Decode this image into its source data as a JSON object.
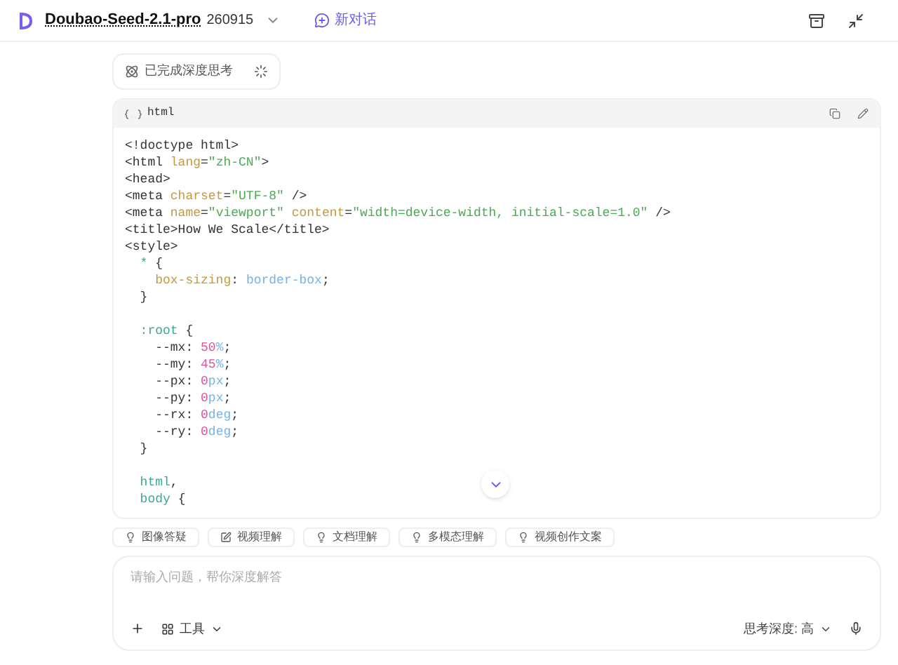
{
  "header": {
    "model": "Doubao-Seed-2.1-pro",
    "version": "260915",
    "new_chat": "新对话"
  },
  "thinking": {
    "label": "已完成深度思考"
  },
  "code_block": {
    "language": "html",
    "lines": [
      {
        "tokens": [
          {
            "kind": "tag",
            "text": "<!doctype html>"
          }
        ]
      },
      {
        "tokens": [
          {
            "kind": "tag",
            "text": "<html "
          },
          {
            "kind": "attr",
            "text": "lang"
          },
          {
            "kind": "tag",
            "text": "="
          },
          {
            "kind": "string",
            "text": "\"zh-CN\""
          },
          {
            "kind": "tag",
            "text": ">"
          }
        ]
      },
      {
        "tokens": [
          {
            "kind": "tag",
            "text": "<head>"
          }
        ]
      },
      {
        "tokens": [
          {
            "kind": "tag",
            "text": "<meta "
          },
          {
            "kind": "attr",
            "text": "charset"
          },
          {
            "kind": "tag",
            "text": "="
          },
          {
            "kind": "string",
            "text": "\"UTF-8\""
          },
          {
            "kind": "tag",
            "text": " />"
          }
        ]
      },
      {
        "tokens": [
          {
            "kind": "tag",
            "text": "<meta "
          },
          {
            "kind": "attr",
            "text": "name"
          },
          {
            "kind": "tag",
            "text": "="
          },
          {
            "kind": "string",
            "text": "\"viewport\""
          },
          {
            "kind": "attr",
            "text": " content"
          },
          {
            "kind": "tag",
            "text": "="
          },
          {
            "kind": "string",
            "text": "\"width=device-width, initial-scale=1.0\""
          },
          {
            "kind": "tag",
            "text": " />"
          }
        ]
      },
      {
        "tokens": [
          {
            "kind": "tag",
            "text": "<title>How We Scale</title>"
          }
        ]
      },
      {
        "tokens": [
          {
            "kind": "tag",
            "text": "<style>"
          }
        ]
      },
      {
        "tokens": [
          {
            "kind": "selector",
            "text": "  * "
          },
          {
            "kind": "tag",
            "text": "{"
          }
        ]
      },
      {
        "tokens": [
          {
            "kind": "attr",
            "text": "    box-sizing"
          },
          {
            "kind": "tag",
            "text": ": "
          },
          {
            "kind": "value",
            "text": "border-box"
          },
          {
            "kind": "tag",
            "text": ";"
          }
        ]
      },
      {
        "tokens": [
          {
            "kind": "tag",
            "text": "  }"
          }
        ]
      },
      {
        "gap_before": true,
        "tokens": [
          {
            "kind": "selector",
            "text": "  :root "
          },
          {
            "kind": "tag",
            "text": "{"
          }
        ]
      },
      {
        "tokens": [
          {
            "kind": "tag",
            "text": "    --mx: "
          },
          {
            "kind": "number",
            "text": "50"
          },
          {
            "kind": "value",
            "text": "%"
          },
          {
            "kind": "tag",
            "text": ";"
          }
        ]
      },
      {
        "tokens": [
          {
            "kind": "tag",
            "text": "    --my: "
          },
          {
            "kind": "number",
            "text": "45"
          },
          {
            "kind": "value",
            "text": "%"
          },
          {
            "kind": "tag",
            "text": ";"
          }
        ]
      },
      {
        "tokens": [
          {
            "kind": "tag",
            "text": "    --px: "
          },
          {
            "kind": "number",
            "text": "0"
          },
          {
            "kind": "value",
            "text": "px"
          },
          {
            "kind": "tag",
            "text": ";"
          }
        ]
      },
      {
        "tokens": [
          {
            "kind": "tag",
            "text": "    --py: "
          },
          {
            "kind": "number",
            "text": "0"
          },
          {
            "kind": "value",
            "text": "px"
          },
          {
            "kind": "tag",
            "text": ";"
          }
        ]
      },
      {
        "tokens": [
          {
            "kind": "tag",
            "text": "    --rx: "
          },
          {
            "kind": "number",
            "text": "0"
          },
          {
            "kind": "value",
            "text": "deg"
          },
          {
            "kind": "tag",
            "text": ";"
          }
        ]
      },
      {
        "tokens": [
          {
            "kind": "tag",
            "text": "    --ry: "
          },
          {
            "kind": "number",
            "text": "0"
          },
          {
            "kind": "value",
            "text": "deg"
          },
          {
            "kind": "tag",
            "text": ";"
          }
        ]
      },
      {
        "tokens": [
          {
            "kind": "tag",
            "text": "  }"
          }
        ]
      },
      {
        "gap_before": true,
        "tokens": [
          {
            "kind": "selector",
            "text": "  html"
          },
          {
            "kind": "tag",
            "text": ","
          }
        ]
      },
      {
        "tokens": [
          {
            "kind": "selector",
            "text": "  body "
          },
          {
            "kind": "tag",
            "text": "{"
          }
        ]
      }
    ]
  },
  "chips": [
    {
      "kind": "bulb",
      "label": "图像答疑"
    },
    {
      "kind": "edit",
      "label": "视频理解"
    },
    {
      "kind": "bulb",
      "label": "文档理解"
    },
    {
      "kind": "bulb",
      "label": "多模态理解"
    },
    {
      "kind": "bulb",
      "label": "视频创作文案"
    }
  ],
  "composer": {
    "placeholder": "请输入问题，帮你深度解答",
    "tools": "工具",
    "depth": "思考深度: 高"
  }
}
